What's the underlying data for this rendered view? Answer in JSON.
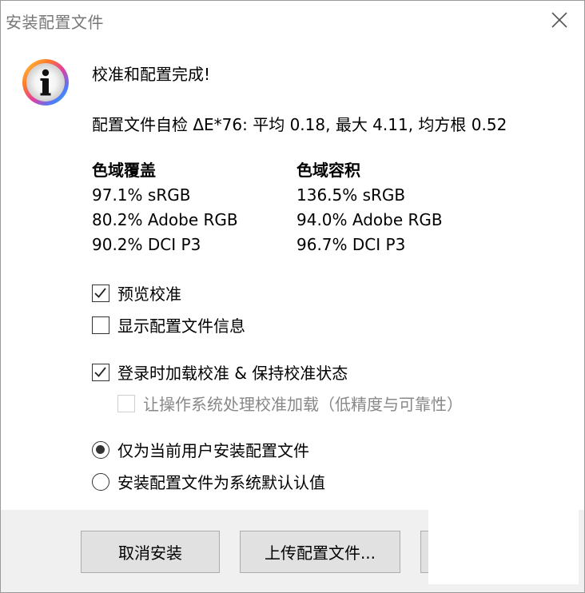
{
  "window": {
    "title": "安装配置文件"
  },
  "message": {
    "heading": "校准和配置完成!",
    "self_check": "配置文件自检 ΔE*76: 平均 0.18, 最大 4.11, 均方根 0.52"
  },
  "gamut": {
    "coverage": {
      "header": "色域覆盖",
      "rows": [
        "97.1% sRGB",
        "80.2% Adobe RGB",
        "90.2% DCI P3"
      ]
    },
    "volume": {
      "header": "色域容积",
      "rows": [
        "136.5% sRGB",
        "94.0% Adobe RGB",
        "96.7% DCI P3"
      ]
    }
  },
  "options": {
    "preview": {
      "label": "预览校准",
      "checked": true
    },
    "show_info": {
      "label": "显示配置文件信息",
      "checked": false
    },
    "load_on_login": {
      "label": "登录时加载校准 & 保持校准状态",
      "checked": true
    },
    "os_handle": {
      "label": "让操作系统处理校准加载（低精度与可靠性）",
      "checked": false,
      "disabled": true
    }
  },
  "install_scope": {
    "current_user": {
      "label": "仅为当前用户安装配置文件",
      "selected": true
    },
    "system_default": {
      "label": "安装配置文件为系统默认认值",
      "selected": false
    }
  },
  "buttons": {
    "cancel": "取消安装",
    "upload": "上传配置文件..."
  },
  "icons": {
    "info": "info-icon",
    "close": "close-icon",
    "check": "check-icon"
  }
}
